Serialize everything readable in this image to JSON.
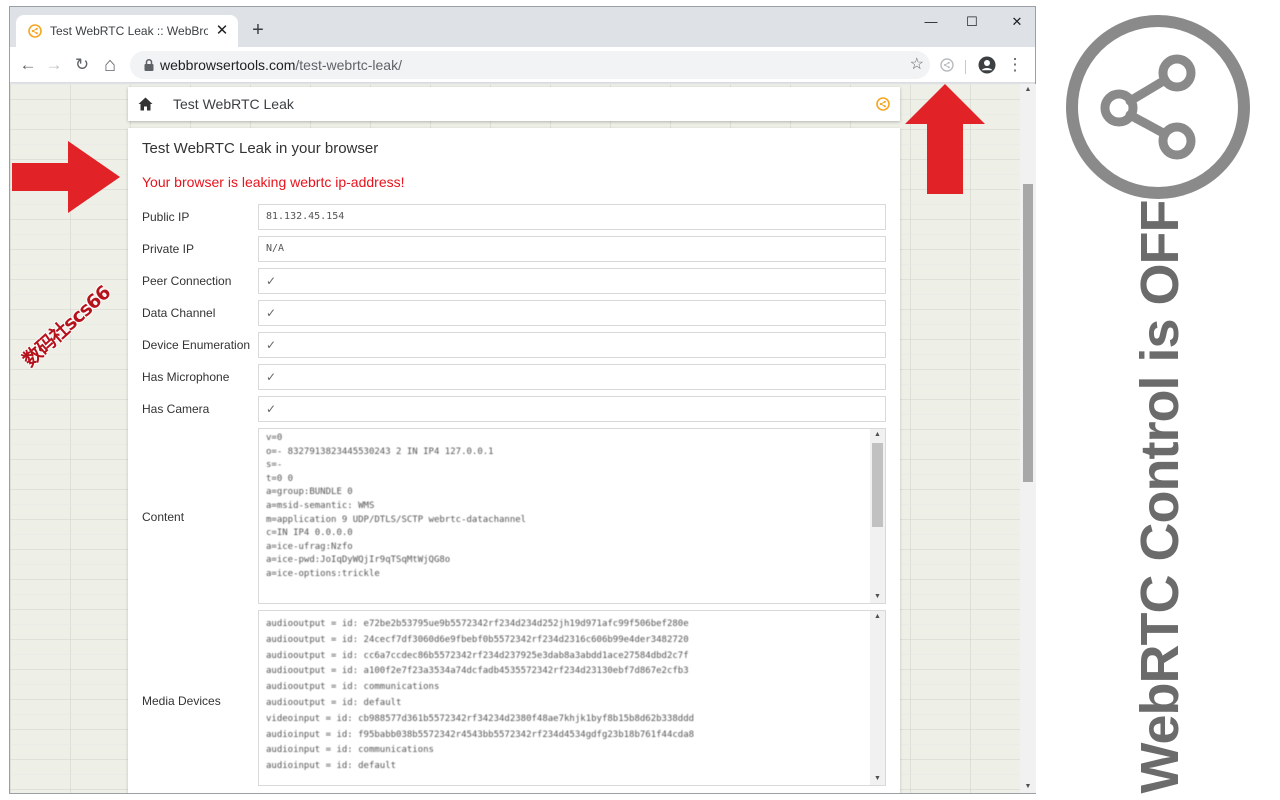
{
  "browser": {
    "tab_title": "Test WebRTC Leak :: WebBrowser",
    "tab_close": "✕",
    "new_tab": "+",
    "url_host": "webbrowsertools.com",
    "url_path": "/test-webrtc-leak/",
    "window_controls": {
      "minimize": "—",
      "maximize": "☐",
      "close": "✕"
    },
    "nav": {
      "back": "←",
      "forward": "→",
      "reload": "↻",
      "home": "⌂",
      "bookmark": "☆",
      "menu": "⋮"
    }
  },
  "page": {
    "header_title": "Test WebRTC Leak",
    "card_title": "Test WebRTC Leak in your browser",
    "leak_message": "Your browser is leaking webrtc ip-address!",
    "rows": [
      {
        "label": "Public IP",
        "value": "81.132.45.154"
      },
      {
        "label": "Private IP",
        "value": "N/A"
      },
      {
        "label": "Peer Connection",
        "value": "✓"
      },
      {
        "label": "Data Channel",
        "value": "✓"
      },
      {
        "label": "Device Enumeration",
        "value": "✓"
      },
      {
        "label": "Has Microphone",
        "value": "✓"
      },
      {
        "label": "Has Camera",
        "value": "✓"
      }
    ],
    "content": {
      "label": "Content",
      "lines": [
        "v=0",
        "o=- 8327913823445530243 2 IN IP4 127.0.0.1",
        "s=-",
        "t=0 0",
        "a=group:BUNDLE 0",
        "a=msid-semantic: WMS",
        "m=application 9 UDP/DTLS/SCTP webrtc-datachannel",
        "c=IN IP4 0.0.0.0",
        "a=ice-ufrag:Nzfo",
        "a=ice-pwd:JoIqDyWQjIr9qTSqMtWjQG8o",
        "a=ice-options:trickle"
      ]
    },
    "media_devices": {
      "label": "Media Devices",
      "lines": [
        "audiooutput = id: e72be2b53795ue9b5572342rf234d234d252jh19d971afc99f506bef280e",
        "audiooutput = id: 24cecf7df3060d6e9fbebf0b5572342rf234d2316c606b99e4der3482720",
        "audiooutput = id: cc6a7ccdec86b5572342rf234d237925e3dab8a3abdd1ace27584dbd2c7f",
        "audiooutput = id: a100f2e7f23a3534a74dcfadb4535572342rf234d23130ebf7d867e2cfb3",
        "audiooutput = id: communications",
        "audiooutput = id: default",
        "videoinput = id: cb988577d361b5572342rf34234d2380f48ae7khjk1byf8b15b8d62b338ddd",
        "audioinput = id: f95babb038b5572342r4543bb5572342rf234d4534gdfg23b18b761f44cda8",
        "audioinput = id: communications",
        "audioinput = id: default"
      ]
    }
  },
  "overlay": {
    "watermark": "数码社scs66",
    "side_caption": "WebRTC Control is OFF"
  },
  "colors": {
    "leak_red": "#e8131c",
    "arrow_red": "#e12227",
    "extension_orange": "#f5a623",
    "side_gray": "#6b6b6b"
  }
}
